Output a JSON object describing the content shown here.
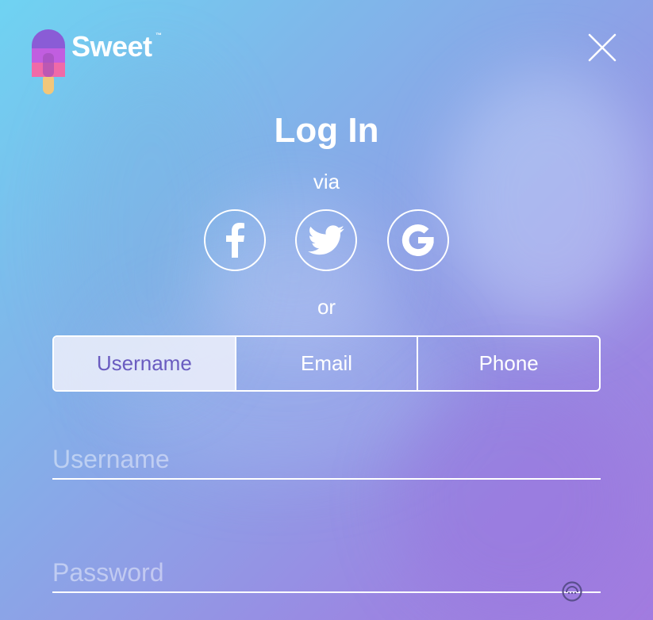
{
  "brand": {
    "name": "Sweet",
    "trademark": "™",
    "logo_icon": "popsicle-icon"
  },
  "header": {
    "close_icon": "close-icon"
  },
  "login": {
    "title": "Log In",
    "via_label": "via",
    "or_label": "or",
    "social": [
      {
        "icon": "facebook-icon"
      },
      {
        "icon": "twitter-icon"
      },
      {
        "icon": "google-icon"
      }
    ]
  },
  "tabs": {
    "username": "Username",
    "email": "Email",
    "phone": "Phone",
    "active": "Username"
  },
  "form": {
    "username_placeholder": "Username",
    "password_placeholder": "Password",
    "password_toggle_icon": "eye-icon"
  },
  "colors": {
    "gradient_start": "#6fd3f2",
    "gradient_end": "#a27be0",
    "active_tab_bg": "#eceefa",
    "active_tab_text": "#6a5cc0",
    "popsicle_top": "#8a5cd6",
    "popsicle_middle": "#c15ee0",
    "popsicle_bottom": "#f06aa8",
    "popsicle_stick": "#f2c77a"
  }
}
